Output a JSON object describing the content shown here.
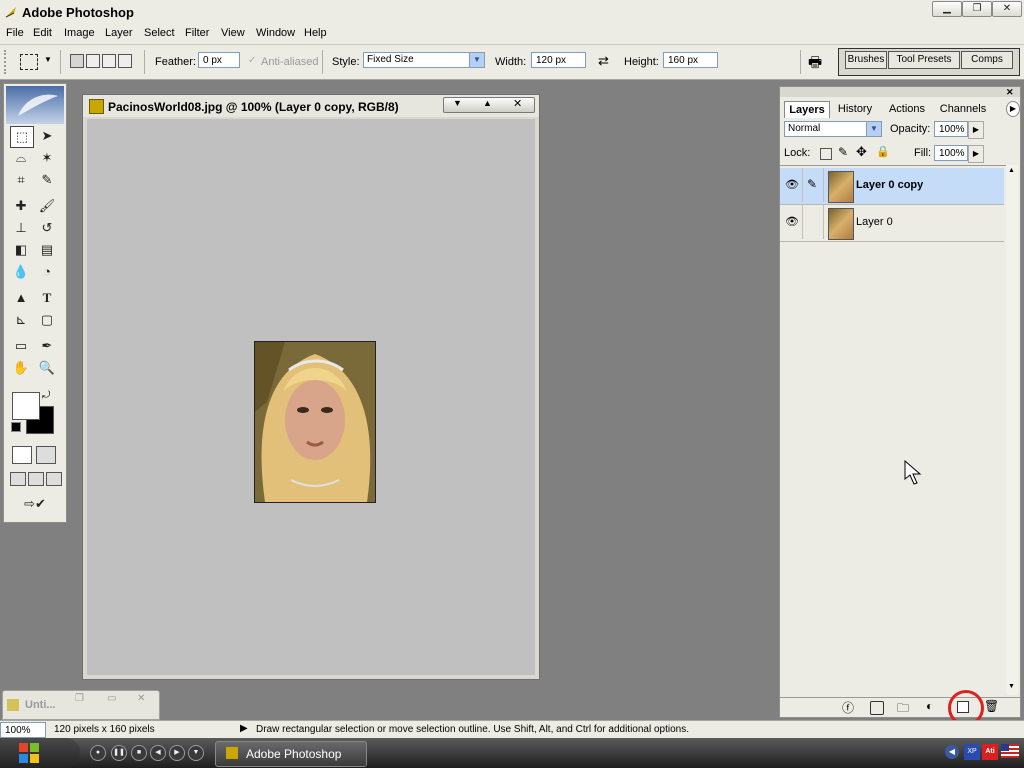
{
  "app": {
    "title": "Adobe Photoshop"
  },
  "window_controls": {
    "minimize": "▁",
    "maximize": "❐",
    "close": "✕"
  },
  "menu": [
    "File",
    "Edit",
    "Image",
    "Layer",
    "Select",
    "Filter",
    "View",
    "Window",
    "Help"
  ],
  "options": {
    "feather_label": "Feather:",
    "feather_value": "0 px",
    "antialiased_label": "Anti-aliased",
    "style_label": "Style:",
    "style_value": "Fixed Size",
    "width_label": "Width:",
    "width_value": "120 px",
    "height_label": "Height:",
    "height_value": "160 px",
    "well_tabs": [
      "Brushes",
      "Tool Presets",
      "Comps"
    ]
  },
  "document": {
    "title": "PacinosWorld08.jpg @ 100% (Layer 0 copy, RGB/8)"
  },
  "minimized_doc": {
    "title": "Unti..."
  },
  "layers_panel": {
    "tabs": [
      "Layers",
      "History",
      "Actions",
      "Channels"
    ],
    "blend_mode": "Normal",
    "opacity_label": "Opacity:",
    "opacity_value": "100%",
    "lock_label": "Lock:",
    "fill_label": "Fill:",
    "fill_value": "100%",
    "layers": [
      {
        "name": "Layer 0 copy",
        "selected": true
      },
      {
        "name": "Layer 0",
        "selected": false
      }
    ]
  },
  "status": {
    "zoom": "100%",
    "doc_info": "120 pixels x 160 pixels",
    "hint": "Draw rectangular selection or move selection outline.  Use Shift, Alt, and Ctrl for additional options."
  },
  "taskbar": {
    "task_label": "Adobe Photoshop"
  },
  "colors": {
    "highlight": "#c4dcf8",
    "annotation_circle": "#e02020"
  }
}
